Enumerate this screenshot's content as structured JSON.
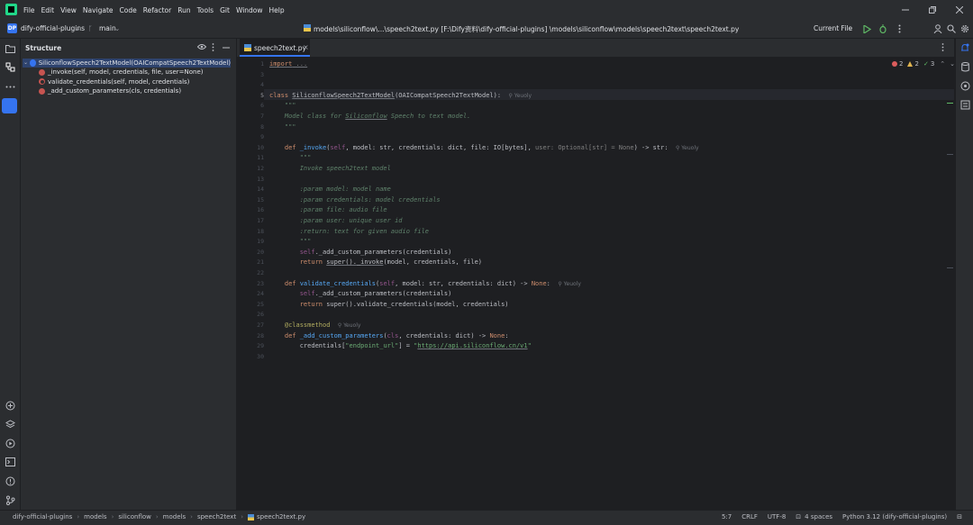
{
  "menu": [
    "File",
    "Edit",
    "View",
    "Navigate",
    "Code",
    "Refactor",
    "Run",
    "Tools",
    "Git",
    "Window",
    "Help"
  ],
  "project": {
    "badge": "DP",
    "name": "dify-official-plugins",
    "branch": "main"
  },
  "file_path": "models\\siliconflow\\...\\speech2text.py [F:\\Dify资料\\dify-official-plugins] \\models\\siliconflow\\models\\speech2text\\speech2text.py",
  "run_config": "Current File",
  "structure": {
    "title": "Structure",
    "root": "SiliconflowSpeech2TextModel(OAICompatSpeech2TextModel)",
    "items": [
      "_invoke(self, model, credentials, file, user=None)",
      "validate_credentials(self, model, credentials)",
      "_add_custom_parameters(cls, credentials)"
    ]
  },
  "tab": {
    "label": "speech2text.py"
  },
  "inspections": {
    "errors": "2",
    "warnings": "2",
    "weak": "3"
  },
  "author": "Yeuoly",
  "code": {
    "l1_import": "import",
    "l1_fold": " ...",
    "l5_class": "class ",
    "l5_name": "SiliconflowSpeech2TextModel",
    "l5_rest": "(OAICompatSpeech2TextModel):",
    "l6": "    \"\"\"",
    "l7_a": "    Model class for ",
    "l7_b": "Siliconflow",
    "l7_c": " Speech to text model.",
    "l8": "    \"\"\"",
    "l10_def": "    def ",
    "l10_fn": "_invoke",
    "l10_a": "(",
    "l10_self": "self",
    "l10_b": ", model: str, credentials: dict, file: IO[bytes], ",
    "l10_c": "user: Optional[str] = None",
    "l10_d": ") -> str:",
    "l11": "        \"\"\"",
    "l12": "        Invoke speech2text model",
    "l14": "        :param model: model name",
    "l15": "        :param credentials: model credentials",
    "l16": "        :param file: audio file",
    "l17": "        :param user: unique user id",
    "l18": "        :return: text for given audio file",
    "l19": "        \"\"\"",
    "l20_self": "        self",
    "l20_rest": "._add_custom_parameters(credentials)",
    "l21_ret": "        return ",
    "l21_super": "super().",
    "l21_inv": "_invoke",
    "l21_rest": "(model, credentials, file)",
    "l23_def": "    def ",
    "l23_fn": "validate_credentials",
    "l23_a": "(",
    "l23_self": "self",
    "l23_b": ", model: str, credentials: dict) -> ",
    "l23_none": "None",
    "l23_c": ":",
    "l24_self": "        self",
    "l24_rest": "._add_custom_parameters(credentials)",
    "l25_ret": "        return ",
    "l25_rest": "super().validate_credentials(model, credentials)",
    "l27": "    @classmethod",
    "l28_def": "    def ",
    "l28_fn": "_add_custom_parameters",
    "l28_a": "(",
    "l28_cls": "cls",
    "l28_b": ", credentials: dict) -> ",
    "l28_none": "None",
    "l28_c": ":",
    "l29_a": "        credentials[",
    "l29_key": "\"endpoint_url\"",
    "l29_b": "] = ",
    "l29_q1": "\"",
    "l29_url": "https://api.siliconflow.cn/v1",
    "l29_q2": "\""
  },
  "status": {
    "breadcrumb": [
      "dify-official-plugins",
      "models",
      "siliconflow",
      "models",
      "speech2text",
      "speech2text.py"
    ],
    "position": "5:7",
    "line_sep": "CRLF",
    "encoding": "UTF-8",
    "indent": "4 spaces",
    "interpreter": "Python 3.12 (dify-official-plugins)"
  }
}
